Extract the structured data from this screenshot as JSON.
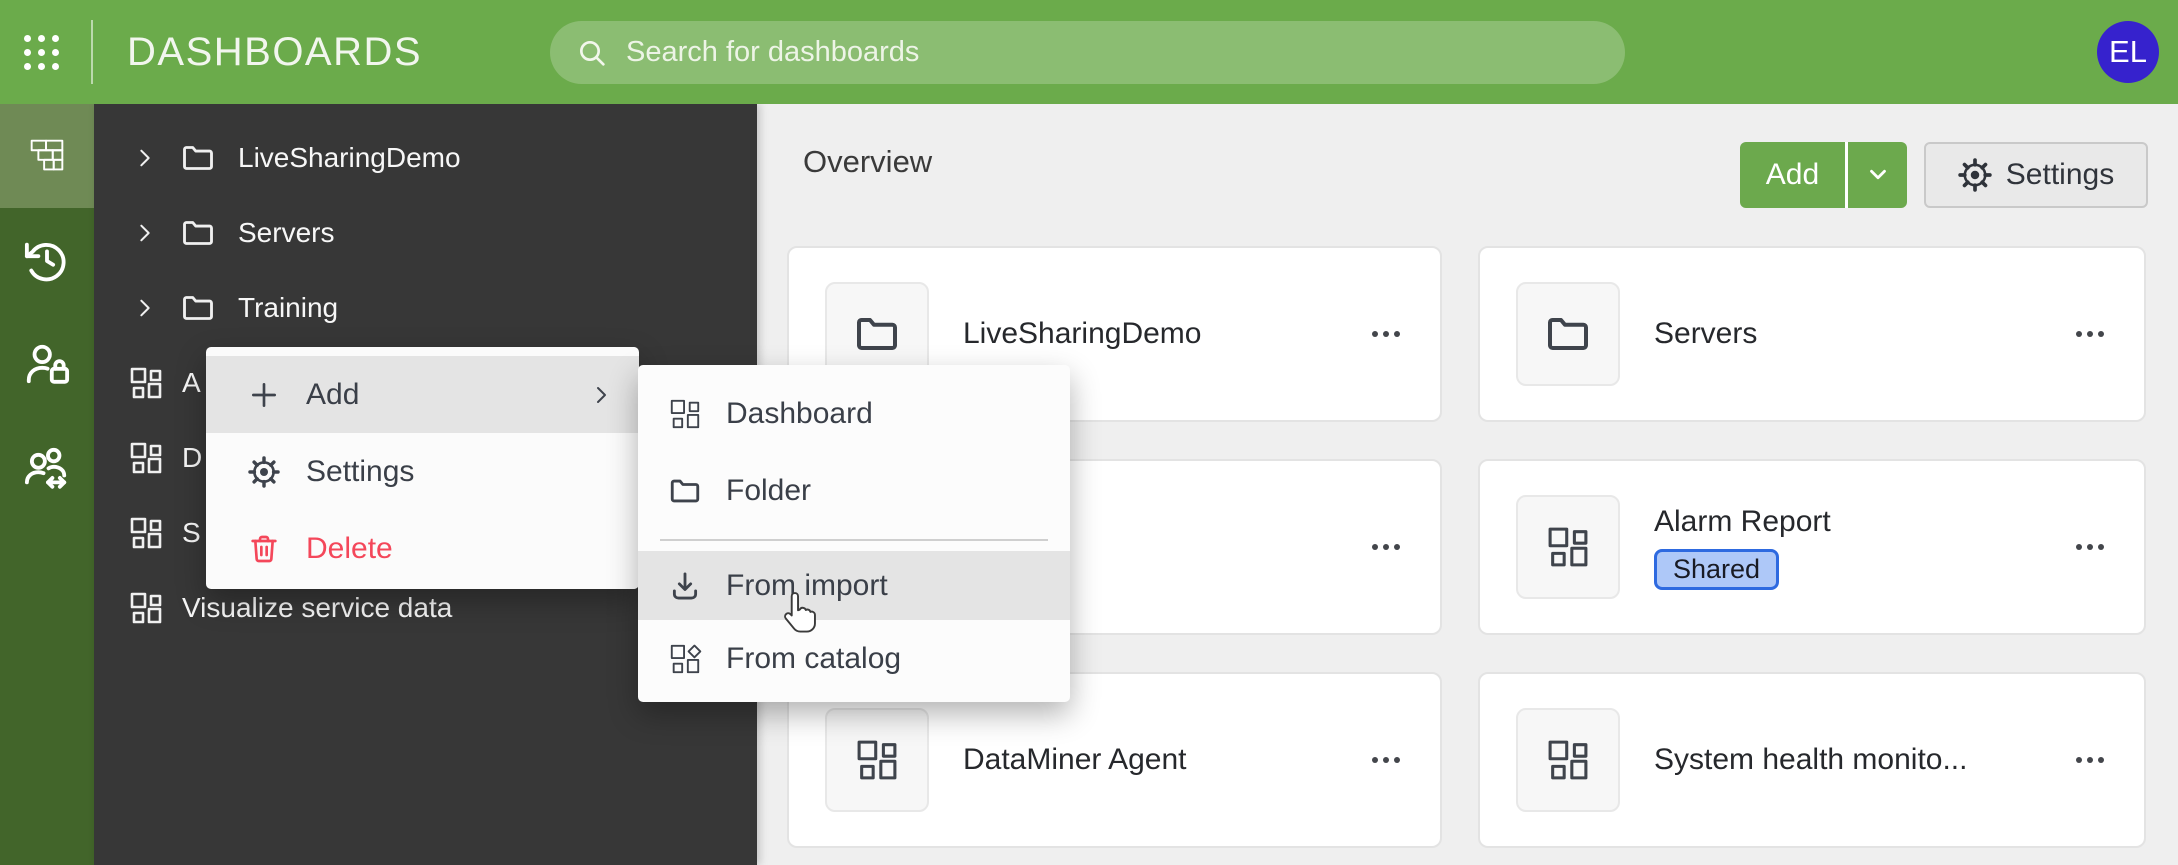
{
  "colors": {
    "c-topbar": "#6BAB4B",
    "c-rail": "#42652A",
    "c-rail-active": "#6F8A55",
    "c-sidebar": "#373737",
    "c-main-bg": "#EFEFEF",
    "c-accent-green": "#6CA94D",
    "c-menu-highlight": "#E4E4E4",
    "c-danger": "#F4475A",
    "c-badge-bg": "#AEC8F8",
    "c-badge-border": "#2E6AE0",
    "c-avatar": "#3622CD"
  },
  "app": {
    "title": "DASHBOARDS"
  },
  "topbar": {
    "search_placeholder": "Search for dashboards",
    "avatar_initials": "EL"
  },
  "rail": {
    "icons": [
      "dashboards-tiles",
      "history",
      "user-permissions",
      "live-sharing"
    ]
  },
  "sidebar": {
    "folders": [
      {
        "label": "LiveSharingDemo"
      },
      {
        "label": "Servers"
      },
      {
        "label": "Training"
      }
    ],
    "dashboards": [
      {
        "label": "A"
      },
      {
        "label": "D"
      },
      {
        "label": "S"
      },
      {
        "label": "Visualize service data"
      }
    ]
  },
  "context_menu": {
    "add_label": "Add",
    "settings_label": "Settings",
    "delete_label": "Delete"
  },
  "submenu": {
    "dashboard_label": "Dashboard",
    "folder_label": "Folder",
    "from_import_label": "From import",
    "from_catalog_label": "From catalog"
  },
  "main": {
    "title": "Overview",
    "add_button_label": "Add",
    "settings_button_label": "Settings",
    "cards": [
      {
        "title": "LiveSharingDemo",
        "type": "folder"
      },
      {
        "title": "Servers",
        "type": "folder"
      },
      {
        "title": "",
        "type": "dashboard"
      },
      {
        "title": "Alarm Report",
        "type": "dashboard",
        "badge": "Shared"
      },
      {
        "title": "DataMiner Agent",
        "type": "dashboard"
      },
      {
        "title": "System health monito...",
        "type": "dashboard"
      }
    ]
  }
}
